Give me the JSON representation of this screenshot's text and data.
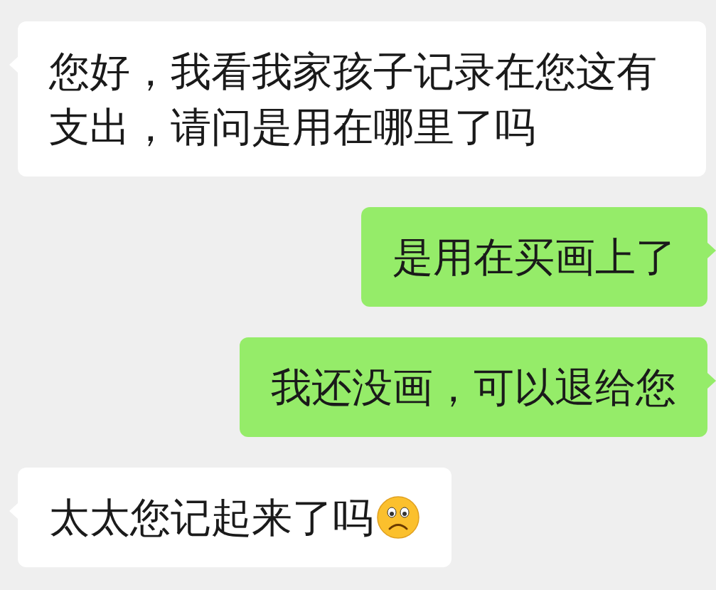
{
  "messages": [
    {
      "kind": "received",
      "text": "您好，我看我家孩子记录在您这有支出，请问是用在哪里了吗",
      "trailing_emoji": false
    },
    {
      "kind": "sent",
      "text": "是用在买画上了",
      "trailing_emoji": false
    },
    {
      "kind": "sent",
      "text": "我还没画，可以退给您",
      "trailing_emoji": false
    },
    {
      "kind": "received",
      "text": "太太您记起来了吗",
      "trailing_emoji": true
    }
  ]
}
